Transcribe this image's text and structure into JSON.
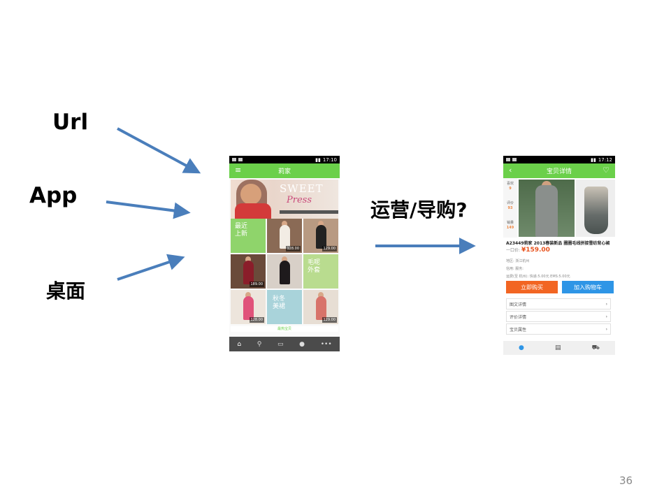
{
  "labels": {
    "url": "Url",
    "app": "App",
    "desktop": "桌面",
    "ops": "运营/导购?"
  },
  "page_number": "36",
  "phone1": {
    "status_time": "17:10",
    "title": "莉家",
    "menu_icon": "menu-icon",
    "banner": {
      "line1": "SWEET",
      "line2": "Press"
    },
    "tiles": [
      {
        "label": "最近\n上新"
      },
      {
        "label": "毛呢\n外套"
      },
      {
        "label": "秋冬\n美裙"
      }
    ],
    "prices": [
      "128.00",
      "128.00",
      "189.00",
      "129.00",
      "129.00"
    ],
    "hot_label": "最热宝贝",
    "nav_icons": [
      "home-icon",
      "search-icon",
      "chat-icon",
      "user-icon",
      "more-icon"
    ]
  },
  "phone2": {
    "status_time": "17:12",
    "title": "宝贝详情",
    "side": [
      {
        "label": "喜欢",
        "value": "9"
      },
      {
        "label": "评价",
        "value": "93"
      },
      {
        "label": "销量",
        "value": "149"
      }
    ],
    "product_title": "A23449莉家 2013春装新品 圈圈毛线拼接雪纺背心裙",
    "price_prefix": "一口价:",
    "price": "¥159.00",
    "region": "地区: 浙江杭州",
    "credit": "信用: 服务:",
    "shipping": "运费(至 杭州): 快递:5.00元  EMS:5.00元",
    "buy_label": "立即购买",
    "cart_label": "加入购物车",
    "rows": [
      "图文详情",
      "评价详情",
      "宝贝属性"
    ]
  },
  "colors": {
    "green": "#6bd04a",
    "arrow": "#4a7ebb",
    "orange": "#f26522",
    "blue": "#2e95e6"
  }
}
